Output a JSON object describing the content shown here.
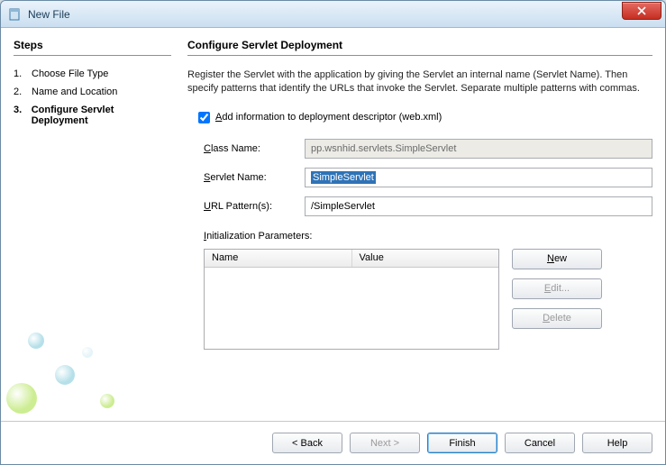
{
  "window": {
    "title": "New File"
  },
  "steps": {
    "heading": "Steps",
    "items": [
      {
        "num": "1.",
        "label": "Choose File Type",
        "current": false
      },
      {
        "num": "2.",
        "label": "Name and Location",
        "current": false
      },
      {
        "num": "3.",
        "label": "Configure Servlet Deployment",
        "current": true
      }
    ]
  },
  "section": {
    "heading": "Configure Servlet Deployment",
    "description": "Register the Servlet with the application by giving the Servlet an internal name (Servlet Name). Then specify patterns that identify the URLs that invoke the Servlet. Separate multiple patterns with commas."
  },
  "checkbox": {
    "label": "Add information to deployment descriptor (web.xml)",
    "checked": true
  },
  "fields": {
    "className": {
      "label": "Class Name:",
      "value": "pp.wsnhid.servlets.SimpleServlet",
      "readonly": true
    },
    "servletName": {
      "label": "Servlet Name:",
      "value": "SimpleServlet",
      "readonly": false,
      "selected": true
    },
    "urlPatterns": {
      "label": "URL Pattern(s):",
      "value": "/SimpleServlet",
      "readonly": false
    }
  },
  "params": {
    "label": "Initialization Parameters:",
    "columns": {
      "name": "Name",
      "value": "Value"
    },
    "rows": [],
    "buttons": {
      "new": "New",
      "edit": "Edit...",
      "delete": "Delete"
    }
  },
  "footer": {
    "back": "< Back",
    "next": "Next >",
    "finish": "Finish",
    "cancel": "Cancel",
    "help": "Help"
  }
}
